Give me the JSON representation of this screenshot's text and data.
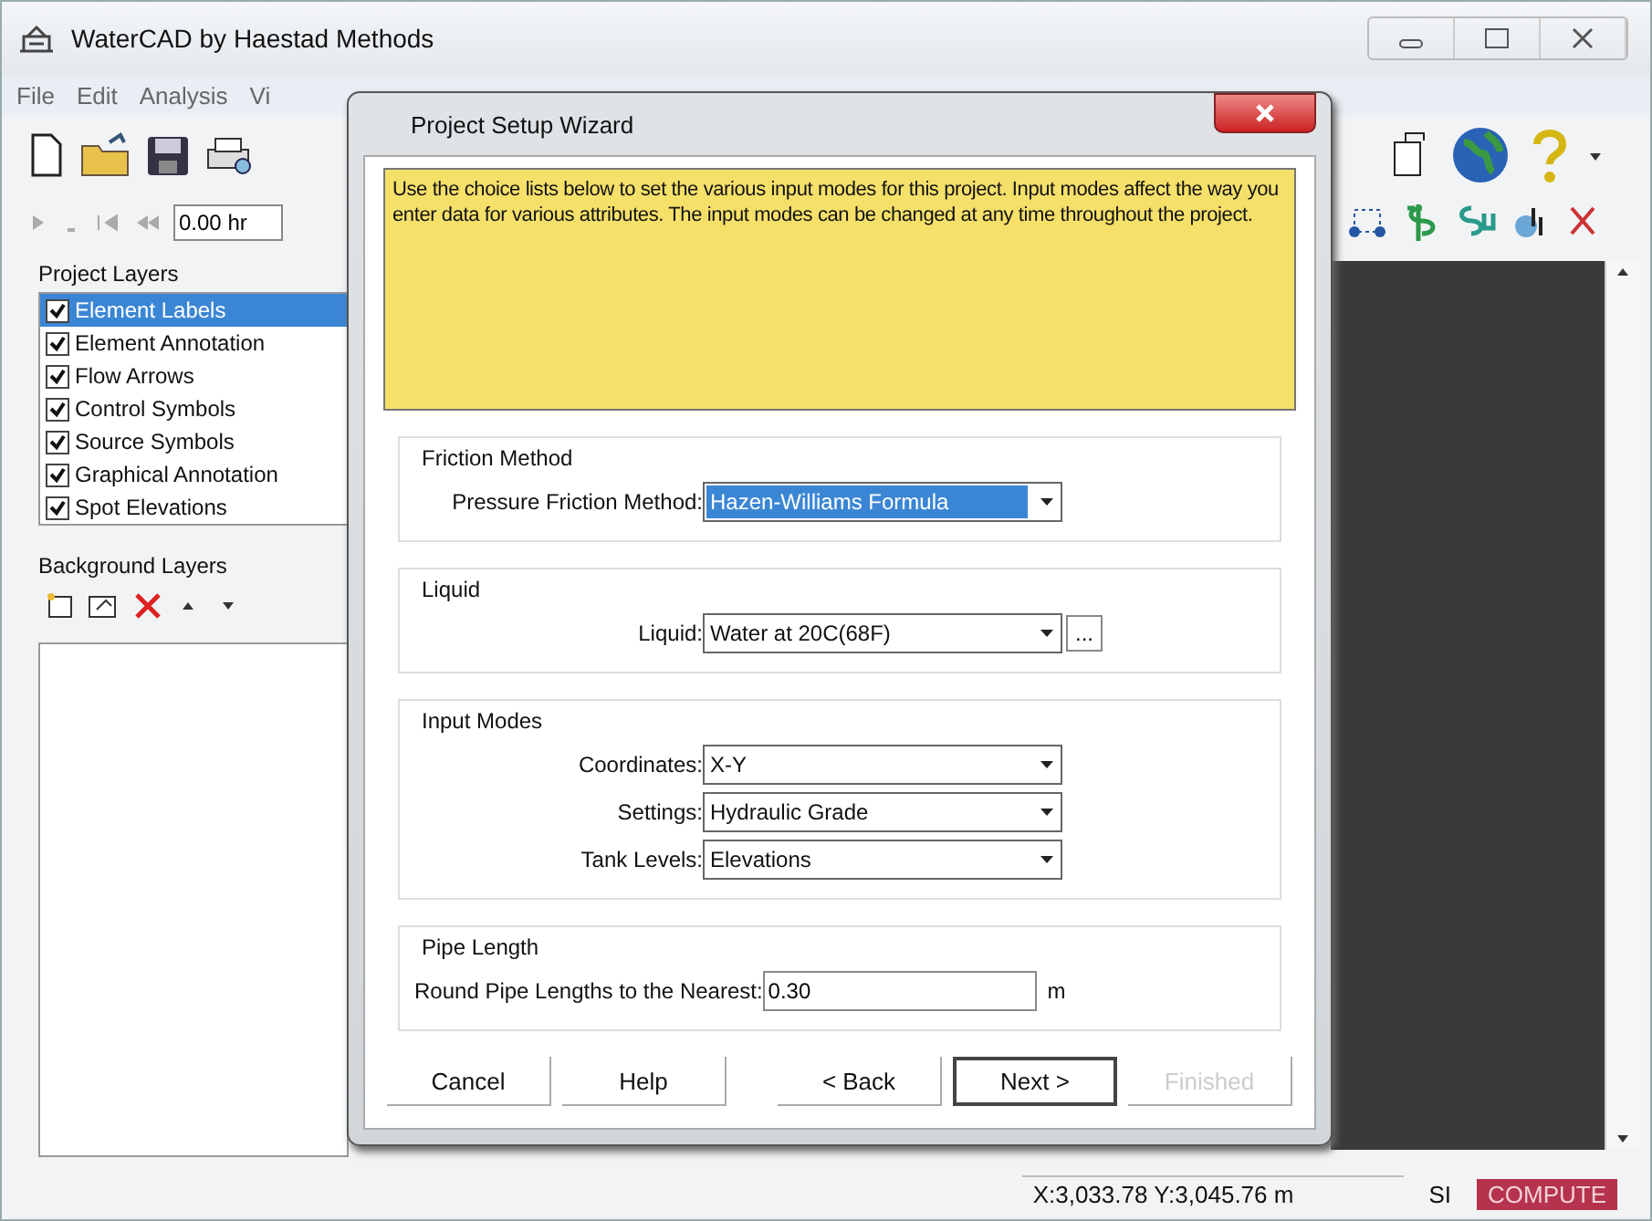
{
  "window": {
    "title": "WaterCAD by Haestad Methods"
  },
  "menu": [
    "File",
    "Edit",
    "Analysis",
    "Vi"
  ],
  "time_field": {
    "value": "0.00 hr"
  },
  "project_layers": {
    "title": "Project Layers",
    "items": [
      {
        "label": "Element Labels",
        "checked": true,
        "selected": true
      },
      {
        "label": "Element Annotation",
        "checked": true,
        "selected": false
      },
      {
        "label": "Flow Arrows",
        "checked": true,
        "selected": false
      },
      {
        "label": "Control Symbols",
        "checked": true,
        "selected": false
      },
      {
        "label": "Source Symbols",
        "checked": true,
        "selected": false
      },
      {
        "label": "Graphical Annotation",
        "checked": true,
        "selected": false
      },
      {
        "label": "Spot Elevations",
        "checked": true,
        "selected": false
      }
    ]
  },
  "background_layers": {
    "title": "Background Layers"
  },
  "dialog": {
    "title": "Project Setup Wizard",
    "description": "Use the choice lists below to set the various input modes for this project. Input modes affect the way you enter data for various attributes. The input modes can be changed at any time throughout the project.",
    "groups": [
      {
        "title": "Friction Method",
        "fields": [
          {
            "kind": "dropdown",
            "label": "Pressure Friction Method:",
            "value": "Hazen-Williams Formula",
            "highlighted": true
          }
        ]
      },
      {
        "title": "Liquid",
        "fields": [
          {
            "kind": "dropdown",
            "label": "Liquid:",
            "value": "Water at 20C(68F)",
            "highlighted": false,
            "browse": "..."
          }
        ]
      },
      {
        "title": "Input Modes",
        "fields": [
          {
            "kind": "dropdown",
            "label": "Coordinates:",
            "value": "X-Y",
            "highlighted": false
          },
          {
            "kind": "dropdown",
            "label": "Settings:",
            "value": "Hydraulic Grade",
            "highlighted": false
          },
          {
            "kind": "dropdown",
            "label": "Tank Levels:",
            "value": "Elevations",
            "highlighted": false
          }
        ]
      },
      {
        "title": "Pipe Length",
        "fields": [
          {
            "kind": "text",
            "label": "Round Pipe Lengths to the Nearest:",
            "value": "0.30",
            "unit": "m"
          }
        ]
      }
    ],
    "buttons_left": [
      {
        "label": "Cancel",
        "disabled": false,
        "default": false
      },
      {
        "label": "Help",
        "disabled": false,
        "default": false
      }
    ],
    "buttons_right": [
      {
        "label": "< Back",
        "disabled": false,
        "default": false
      },
      {
        "label": "Next >",
        "disabled": false,
        "default": true
      },
      {
        "label": "Finished",
        "disabled": true,
        "default": false
      }
    ]
  },
  "status_bar": {
    "coordinates": "X:3,033.78 Y:3,045.76 m",
    "units": "SI",
    "compute": "COMPUTE"
  }
}
